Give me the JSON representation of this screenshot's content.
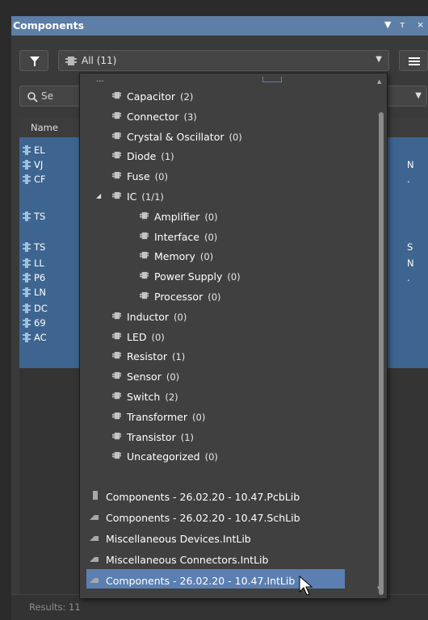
{
  "panel": {
    "title": "Components",
    "pin_icon": "pin-icon",
    "close_icon": "close-icon",
    "dropdown_arrow": "▾",
    "controls": {
      "pin_label": "▾  ⊥",
      "close_label": "×"
    }
  },
  "toolbar": {
    "filter_icon": "filter-icon",
    "category_combo_value": "All  (11)",
    "combo_arrow": "▾",
    "menu_icon": "hamburger-menu-icon"
  },
  "search": {
    "value": "Se",
    "icon": "search-icon"
  },
  "grid": {
    "header_name": "Name",
    "rows": [
      {
        "name": "EL",
        "right": ""
      },
      {
        "name": "VJ",
        "right": "N"
      },
      {
        "name": "CF",
        "right": "."
      },
      {
        "name": "TS",
        "right": ""
      },
      {
        "name": "TS",
        "right": "S"
      },
      {
        "name": "LL",
        "right": "N"
      },
      {
        "name": "P6",
        "right": "."
      },
      {
        "name": "LN",
        "right": ""
      },
      {
        "name": "DC",
        "right": ""
      },
      {
        "name": "69",
        "right": ""
      },
      {
        "name": "AC",
        "right": ""
      }
    ]
  },
  "status": {
    "results": "Results: 11"
  },
  "dropdown": {
    "partial_top": "...",
    "items": [
      {
        "label": "Capacitor",
        "count": "(2)"
      },
      {
        "label": "Connector",
        "count": "(3)"
      },
      {
        "label": "Crystal & Oscillator",
        "count": "(0)"
      },
      {
        "label": "Diode",
        "count": "(1)"
      },
      {
        "label": "Fuse",
        "count": "(0)"
      },
      {
        "label": "IC",
        "count": "(1/1)",
        "expanded": true
      },
      {
        "label": "Amplifier",
        "count": "(0)"
      },
      {
        "label": "Interface",
        "count": "(0)"
      },
      {
        "label": "Memory",
        "count": "(0)"
      },
      {
        "label": "Power Supply",
        "count": "(0)"
      },
      {
        "label": "Processor",
        "count": "(0)"
      },
      {
        "label": "Inductor",
        "count": "(0)"
      },
      {
        "label": "LED",
        "count": "(0)"
      },
      {
        "label": "Resistor",
        "count": "(1)"
      },
      {
        "label": "Sensor",
        "count": "(0)"
      },
      {
        "label": "Switch",
        "count": "(2)"
      },
      {
        "label": "Transformer",
        "count": "(0)"
      },
      {
        "label": "Transistor",
        "count": "(1)"
      },
      {
        "label": "Uncategorized",
        "count": "(0)"
      }
    ],
    "libraries": [
      {
        "label": "Components - 26.02.20 - 10.47.PcbLib",
        "icon": "pcblib-icon"
      },
      {
        "label": "Components - 26.02.20 - 10.47.SchLib",
        "icon": "schlib-icon"
      },
      {
        "label": "Miscellaneous Devices.IntLib",
        "icon": "intlib-icon"
      },
      {
        "label": "Miscellaneous Connectors.IntLib",
        "icon": "intlib-icon"
      },
      {
        "label": "Components - 26.02.20 - 10.47.IntLib",
        "icon": "intlib-icon",
        "selected": true
      }
    ]
  },
  "colors": {
    "title_bar": "#5d7ea6",
    "selection": "#5b7fb0",
    "grid_selection": "#3d6590",
    "chip": "#b9b9b9"
  }
}
